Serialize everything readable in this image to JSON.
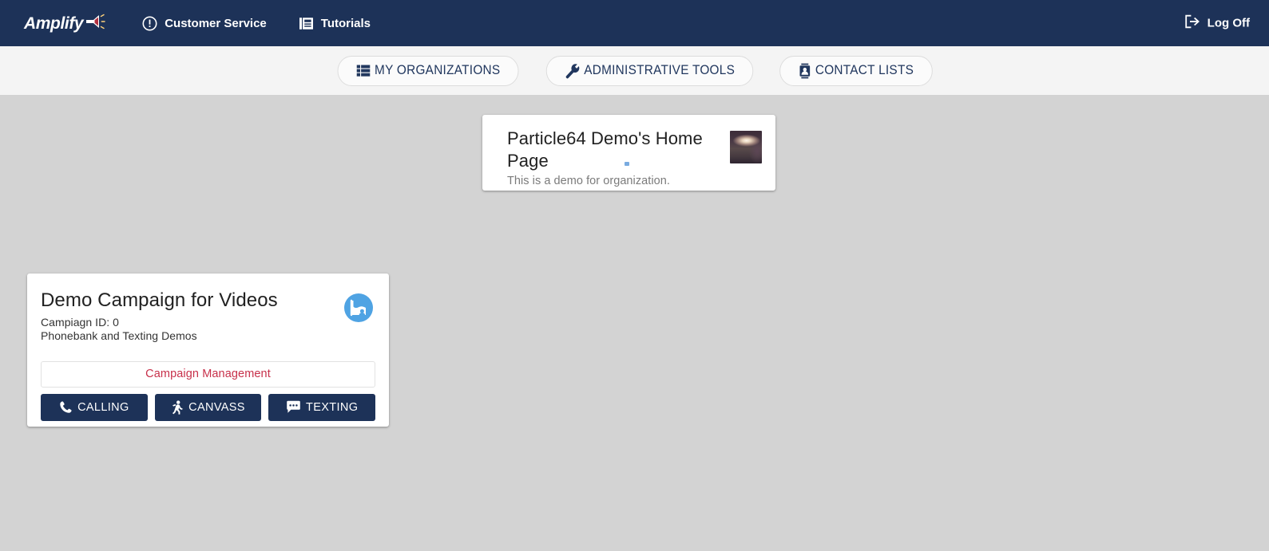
{
  "header": {
    "brand": {
      "word": "Amplify",
      "icon": "megaphone-icon"
    },
    "nav": [
      {
        "label": "Customer Service",
        "icon": "exclamation-circle-icon"
      },
      {
        "label": "Tutorials",
        "icon": "book-document-icon"
      }
    ],
    "logoff": {
      "label": "Log Off",
      "icon": "logout-icon"
    }
  },
  "subnav": {
    "buttons": [
      {
        "label": "MY ORGANIZATIONS",
        "icon": "list-grid-icon"
      },
      {
        "label": "ADMINISTRATIVE TOOLS",
        "icon": "wrench-icon"
      },
      {
        "label": "CONTACT LISTS",
        "icon": "contact-card-icon"
      }
    ]
  },
  "organization_card": {
    "title": "Particle64 Demo's Home Page",
    "subtitle": "This is a demo for organization.",
    "thumbnail_alt": "organization-thumbnail"
  },
  "campaign_card": {
    "title": "Demo Campaign for Videos",
    "campaign_id_label": "Campiagn ID: 0",
    "description": "Phonebank and Texting Demos",
    "icon": "campaign-flag-icon",
    "management_link": "Campaign Management",
    "actions": [
      {
        "label": "CALLING",
        "icon": "phone-icon"
      },
      {
        "label": "CANVASS",
        "icon": "walking-person-icon"
      },
      {
        "label": "TEXTING",
        "icon": "chat-bubble-icon"
      }
    ]
  },
  "colors": {
    "header_navy": "#1d3258",
    "page_background": "#d3d3d3",
    "subnav_background": "#f4f4f4",
    "link_red": "#c7304a",
    "campaign_icon_blue": "#4fa3e3"
  }
}
